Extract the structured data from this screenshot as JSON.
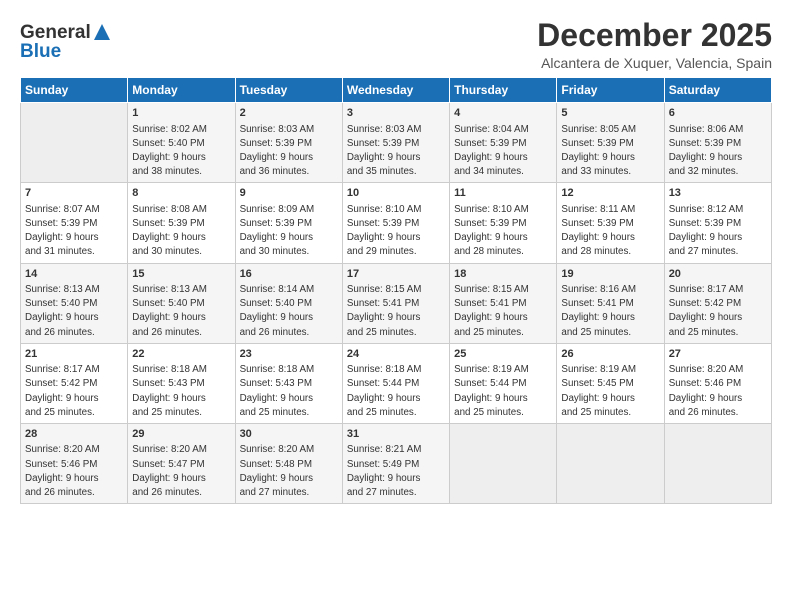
{
  "logo": {
    "general": "General",
    "blue": "Blue"
  },
  "title": "December 2025",
  "subtitle": "Alcantera de Xuquer, Valencia, Spain",
  "days_of_week": [
    "Sunday",
    "Monday",
    "Tuesday",
    "Wednesday",
    "Thursday",
    "Friday",
    "Saturday"
  ],
  "weeks": [
    [
      {
        "day": "",
        "info": ""
      },
      {
        "day": "1",
        "info": "Sunrise: 8:02 AM\nSunset: 5:40 PM\nDaylight: 9 hours\nand 38 minutes."
      },
      {
        "day": "2",
        "info": "Sunrise: 8:03 AM\nSunset: 5:39 PM\nDaylight: 9 hours\nand 36 minutes."
      },
      {
        "day": "3",
        "info": "Sunrise: 8:03 AM\nSunset: 5:39 PM\nDaylight: 9 hours\nand 35 minutes."
      },
      {
        "day": "4",
        "info": "Sunrise: 8:04 AM\nSunset: 5:39 PM\nDaylight: 9 hours\nand 34 minutes."
      },
      {
        "day": "5",
        "info": "Sunrise: 8:05 AM\nSunset: 5:39 PM\nDaylight: 9 hours\nand 33 minutes."
      },
      {
        "day": "6",
        "info": "Sunrise: 8:06 AM\nSunset: 5:39 PM\nDaylight: 9 hours\nand 32 minutes."
      }
    ],
    [
      {
        "day": "7",
        "info": "Sunrise: 8:07 AM\nSunset: 5:39 PM\nDaylight: 9 hours\nand 31 minutes."
      },
      {
        "day": "8",
        "info": "Sunrise: 8:08 AM\nSunset: 5:39 PM\nDaylight: 9 hours\nand 30 minutes."
      },
      {
        "day": "9",
        "info": "Sunrise: 8:09 AM\nSunset: 5:39 PM\nDaylight: 9 hours\nand 30 minutes."
      },
      {
        "day": "10",
        "info": "Sunrise: 8:10 AM\nSunset: 5:39 PM\nDaylight: 9 hours\nand 29 minutes."
      },
      {
        "day": "11",
        "info": "Sunrise: 8:10 AM\nSunset: 5:39 PM\nDaylight: 9 hours\nand 28 minutes."
      },
      {
        "day": "12",
        "info": "Sunrise: 8:11 AM\nSunset: 5:39 PM\nDaylight: 9 hours\nand 28 minutes."
      },
      {
        "day": "13",
        "info": "Sunrise: 8:12 AM\nSunset: 5:39 PM\nDaylight: 9 hours\nand 27 minutes."
      }
    ],
    [
      {
        "day": "14",
        "info": "Sunrise: 8:13 AM\nSunset: 5:40 PM\nDaylight: 9 hours\nand 26 minutes."
      },
      {
        "day": "15",
        "info": "Sunrise: 8:13 AM\nSunset: 5:40 PM\nDaylight: 9 hours\nand 26 minutes."
      },
      {
        "day": "16",
        "info": "Sunrise: 8:14 AM\nSunset: 5:40 PM\nDaylight: 9 hours\nand 26 minutes."
      },
      {
        "day": "17",
        "info": "Sunrise: 8:15 AM\nSunset: 5:41 PM\nDaylight: 9 hours\nand 25 minutes."
      },
      {
        "day": "18",
        "info": "Sunrise: 8:15 AM\nSunset: 5:41 PM\nDaylight: 9 hours\nand 25 minutes."
      },
      {
        "day": "19",
        "info": "Sunrise: 8:16 AM\nSunset: 5:41 PM\nDaylight: 9 hours\nand 25 minutes."
      },
      {
        "day": "20",
        "info": "Sunrise: 8:17 AM\nSunset: 5:42 PM\nDaylight: 9 hours\nand 25 minutes."
      }
    ],
    [
      {
        "day": "21",
        "info": "Sunrise: 8:17 AM\nSunset: 5:42 PM\nDaylight: 9 hours\nand 25 minutes."
      },
      {
        "day": "22",
        "info": "Sunrise: 8:18 AM\nSunset: 5:43 PM\nDaylight: 9 hours\nand 25 minutes."
      },
      {
        "day": "23",
        "info": "Sunrise: 8:18 AM\nSunset: 5:43 PM\nDaylight: 9 hours\nand 25 minutes."
      },
      {
        "day": "24",
        "info": "Sunrise: 8:18 AM\nSunset: 5:44 PM\nDaylight: 9 hours\nand 25 minutes."
      },
      {
        "day": "25",
        "info": "Sunrise: 8:19 AM\nSunset: 5:44 PM\nDaylight: 9 hours\nand 25 minutes."
      },
      {
        "day": "26",
        "info": "Sunrise: 8:19 AM\nSunset: 5:45 PM\nDaylight: 9 hours\nand 25 minutes."
      },
      {
        "day": "27",
        "info": "Sunrise: 8:20 AM\nSunset: 5:46 PM\nDaylight: 9 hours\nand 26 minutes."
      }
    ],
    [
      {
        "day": "28",
        "info": "Sunrise: 8:20 AM\nSunset: 5:46 PM\nDaylight: 9 hours\nand 26 minutes."
      },
      {
        "day": "29",
        "info": "Sunrise: 8:20 AM\nSunset: 5:47 PM\nDaylight: 9 hours\nand 26 minutes."
      },
      {
        "day": "30",
        "info": "Sunrise: 8:20 AM\nSunset: 5:48 PM\nDaylight: 9 hours\nand 27 minutes."
      },
      {
        "day": "31",
        "info": "Sunrise: 8:21 AM\nSunset: 5:49 PM\nDaylight: 9 hours\nand 27 minutes."
      },
      {
        "day": "",
        "info": ""
      },
      {
        "day": "",
        "info": ""
      },
      {
        "day": "",
        "info": ""
      }
    ]
  ]
}
